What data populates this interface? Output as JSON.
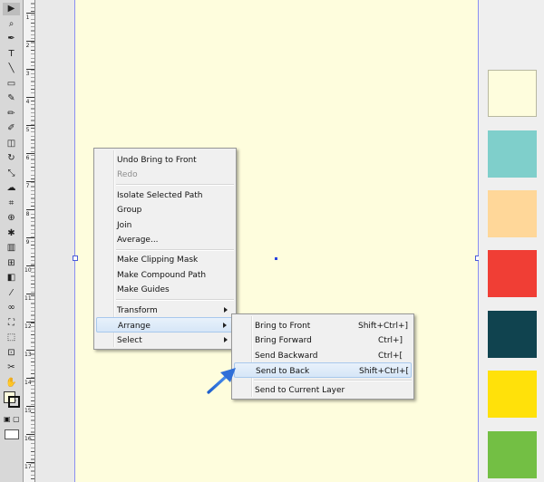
{
  "ruler": {
    "labels": [
      "1",
      "2",
      "3",
      "4",
      "5",
      "6",
      "7",
      "8",
      "9",
      "10",
      "11",
      "12",
      "13",
      "14",
      "15",
      "16",
      "17"
    ]
  },
  "tools": [
    {
      "name": "selection-tool-icon",
      "glyph": "▶",
      "selected": true
    },
    {
      "name": "lasso-tool-icon",
      "glyph": "⌕",
      "selected": false
    },
    {
      "name": "pen-tool-icon",
      "glyph": "✒",
      "selected": false
    },
    {
      "name": "type-tool-icon",
      "glyph": "T",
      "selected": false
    },
    {
      "name": "line-tool-icon",
      "glyph": "╲",
      "selected": false
    },
    {
      "name": "rectangle-tool-icon",
      "glyph": "▭",
      "selected": false
    },
    {
      "name": "paintbrush-tool-icon",
      "glyph": "✎",
      "selected": false
    },
    {
      "name": "pencil-tool-icon",
      "glyph": "✏",
      "selected": false
    },
    {
      "name": "blob-brush-tool-icon",
      "glyph": "✐",
      "selected": false
    },
    {
      "name": "eraser-tool-icon",
      "glyph": "◫",
      "selected": false
    },
    {
      "name": "rotate-tool-icon",
      "glyph": "↻",
      "selected": false
    },
    {
      "name": "scale-tool-icon",
      "glyph": "⤡",
      "selected": false
    },
    {
      "name": "warp-tool-icon",
      "glyph": "☁",
      "selected": false
    },
    {
      "name": "free-transform-tool-icon",
      "glyph": "⌗",
      "selected": false
    },
    {
      "name": "shape-builder-tool-icon",
      "glyph": "⊕",
      "selected": false
    },
    {
      "name": "symbol-sprayer-tool-icon",
      "glyph": "✱",
      "selected": false
    },
    {
      "name": "column-graph-tool-icon",
      "glyph": "▥",
      "selected": false
    },
    {
      "name": "mesh-tool-icon",
      "glyph": "⊞",
      "selected": false
    },
    {
      "name": "gradient-tool-icon",
      "glyph": "◧",
      "selected": false
    },
    {
      "name": "eyedropper-tool-icon",
      "glyph": "⁄",
      "selected": false
    },
    {
      "name": "blend-tool-icon",
      "glyph": "∞",
      "selected": false
    },
    {
      "name": "live-paint-bucket-tool-icon",
      "glyph": "⛶",
      "selected": false
    },
    {
      "name": "live-paint-selection-tool-icon",
      "glyph": "⬚",
      "selected": false
    },
    {
      "name": "artboard-tool-icon",
      "glyph": "⊡",
      "selected": false
    },
    {
      "name": "slice-tool-icon",
      "glyph": "✂",
      "selected": false
    },
    {
      "name": "hand-tool-icon",
      "glyph": "✋",
      "selected": false
    },
    {
      "name": "zoom-tool-icon",
      "glyph": "🔍",
      "selected": false
    }
  ],
  "swatch_colors": [
    "#fefddd",
    "#7fcfcb",
    "#ffd799",
    "#f03e35",
    "#10434f",
    "#ffe10a",
    "#73bf44"
  ],
  "context_menu": {
    "undo": "Undo Bring to Front",
    "redo": "Redo",
    "isolate": "Isolate Selected Path",
    "group": "Group",
    "join": "Join",
    "average": "Average...",
    "clipping_mask": "Make Clipping Mask",
    "compound_path": "Make Compound Path",
    "guides": "Make Guides",
    "transform": "Transform",
    "arrange": "Arrange",
    "select": "Select"
  },
  "arrange_submenu": {
    "bring_to_front": "Bring to Front",
    "bring_to_front_shortcut": "Shift+Ctrl+]",
    "bring_forward": "Bring Forward",
    "bring_forward_shortcut": "Ctrl+]",
    "send_backward": "Send Backward",
    "send_backward_shortcut": "Ctrl+[",
    "send_to_back": "Send to Back",
    "send_to_back_shortcut": "Shift+Ctrl+[",
    "send_to_current_layer": "Send to Current Layer"
  },
  "annotation_arrow_color": "#2f6fd8"
}
